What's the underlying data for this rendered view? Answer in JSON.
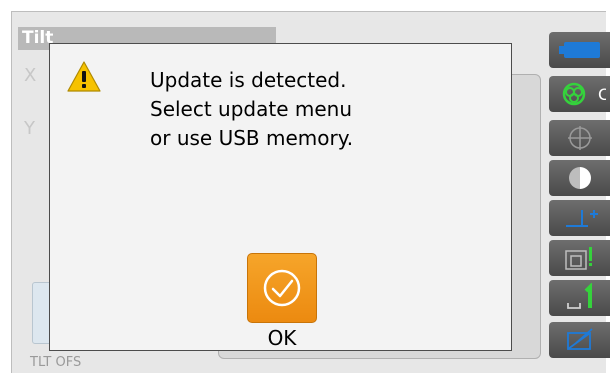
{
  "screen": {
    "title": "Tilt",
    "axes": [
      "X",
      "Y"
    ],
    "footer": "TLT OFS"
  },
  "toolbar": {
    "icons": [
      "battery-icon",
      "laser-target-icon",
      "reticle-icon",
      "half-circle-icon",
      "height-offset-icon",
      "tilt-warning-icon",
      "level-one-icon",
      "pen-edit-icon"
    ],
    "accent_blue": "#1e7ad7",
    "accent_green": "#35d23c",
    "partial_label": "C"
  },
  "dialog": {
    "icon": "warning-icon",
    "message_lines": [
      "Update is detected.",
      "Select update menu",
      "or use USB memory."
    ],
    "ok_label": "OK",
    "ok_color": "#f29b1c"
  }
}
